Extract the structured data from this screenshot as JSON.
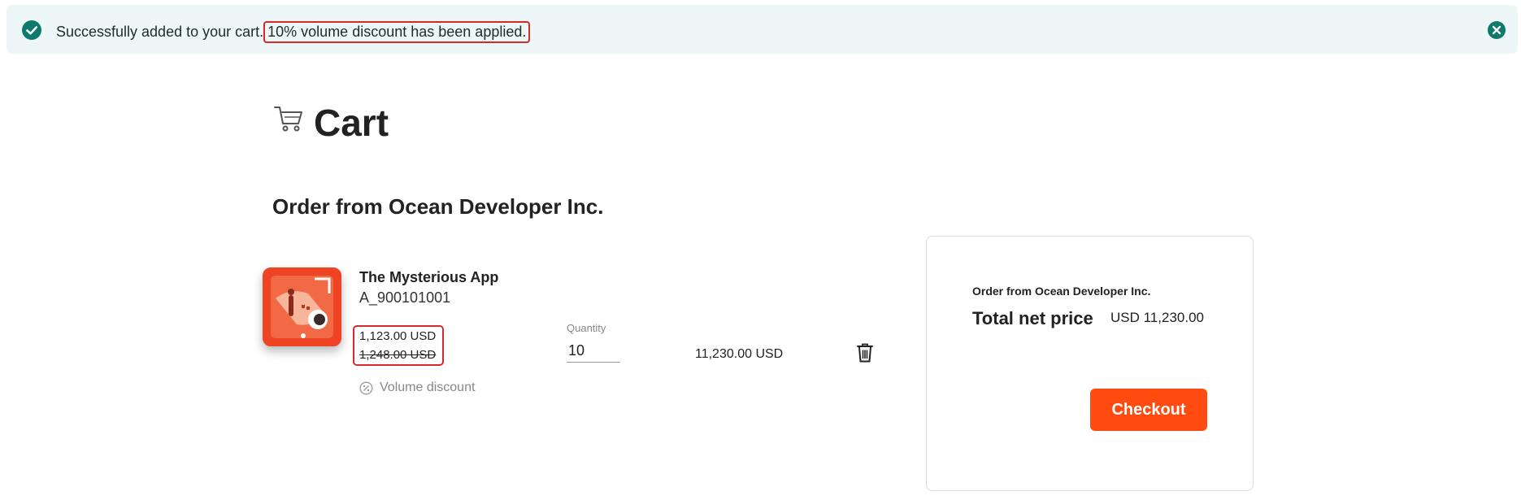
{
  "banner": {
    "message": "Successfully added to your cart.",
    "highlight": "10% volume discount has been applied."
  },
  "page": {
    "title": "Cart"
  },
  "order": {
    "heading": "Order from Ocean Developer Inc."
  },
  "item": {
    "name": "The Mysterious App",
    "sku": "A_900101001",
    "price_discounted": "1,123.00 USD",
    "price_original": "1,248.00 USD",
    "discount_label": "Volume discount",
    "quantity_label": "Quantity",
    "quantity_value": "10",
    "line_total": "11,230.00 USD"
  },
  "summary": {
    "vendor": "Order from Ocean Developer Inc.",
    "total_label": "Total net price",
    "total_value": "USD 11,230.00",
    "checkout_label": "Checkout"
  },
  "colors": {
    "accent": "#ff4b0f",
    "success": "#0e7a6b",
    "highlight_border": "#d62a2a",
    "banner_bg": "#eef7f7"
  },
  "icons": {
    "banner_status": "check-circle-icon",
    "banner_close": "close-circle-icon",
    "title": "cart-icon",
    "discount": "percent-badge-icon",
    "remove": "trash-icon"
  }
}
